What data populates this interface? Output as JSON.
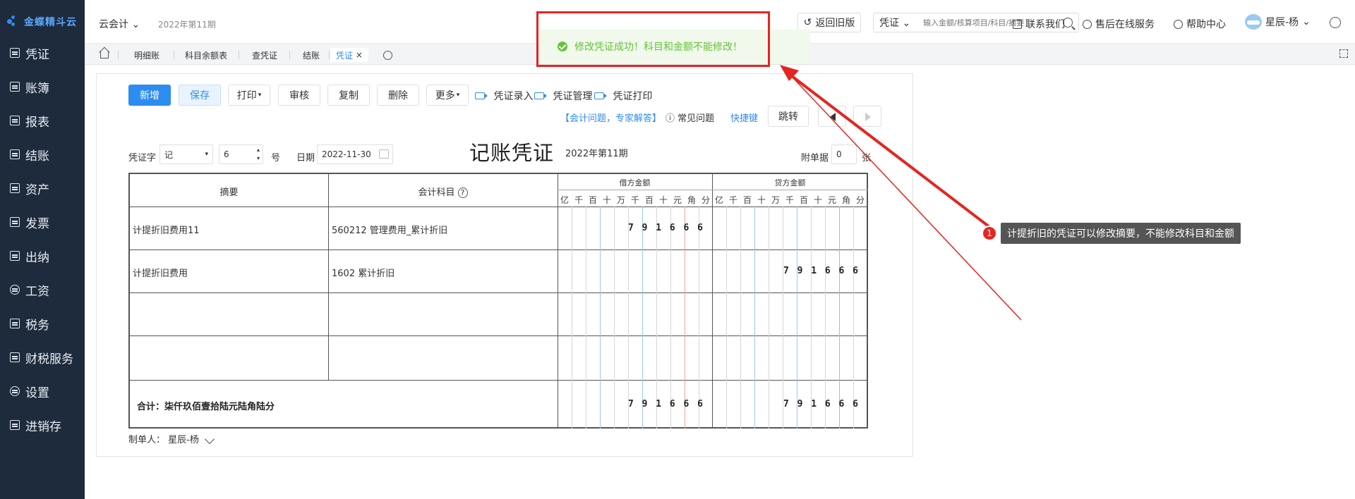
{
  "logo": "金蝶精斗云",
  "sidebar": {
    "items": [
      {
        "label": "凭证"
      },
      {
        "label": "账簿"
      },
      {
        "label": "报表"
      },
      {
        "label": "结账"
      },
      {
        "label": "资产"
      },
      {
        "label": "发票"
      },
      {
        "label": "出纳"
      },
      {
        "label": "工资"
      },
      {
        "label": "税务"
      },
      {
        "label": "财税服务"
      },
      {
        "label": "设置"
      },
      {
        "label": "进销存"
      }
    ]
  },
  "header": {
    "app": "云会计",
    "period": "2022年第11期",
    "return_label": "返回旧版",
    "search_scope": "凭证",
    "search_placeholder": "输入金额/核算项目/科目/摘要",
    "contact": "联系我们",
    "service": "售后在线服务",
    "help": "帮助中心",
    "user": "星辰-杨"
  },
  "tabs": [
    "明细账",
    "科目余额表",
    "查凭证",
    "结账",
    "凭证"
  ],
  "toast": "修改凭证成功！科目和金额不能修改！",
  "toolbar": {
    "new": "新增",
    "save": "保存",
    "print": "打印",
    "audit": "审核",
    "copy": "复制",
    "delete": "删除",
    "more": "更多",
    "entry": "凭证录入",
    "manage": "凭证管理",
    "print_voucher": "凭证打印",
    "qa": "【会计问题，专家解答】",
    "faq": "常见问题",
    "shortcut": "快捷键",
    "jump": "跳转"
  },
  "form": {
    "word_label": "凭证字",
    "word_value": "记",
    "number_value": "6",
    "number_suffix": "号",
    "date_label": "日期",
    "date_value": "2022-11-30",
    "title": "记账凭证",
    "period": "2022年第11期",
    "attach_label": "附单据",
    "attach_value": "0",
    "attach_unit": "张"
  },
  "voucher": {
    "headers": {
      "summary": "摘要",
      "account": "会计科目",
      "debit": "借方金额",
      "credit": "贷方金额"
    },
    "digit_units": [
      "亿",
      "千",
      "百",
      "十",
      "万",
      "千",
      "百",
      "十",
      "元",
      "角",
      "分"
    ],
    "rows": [
      {
        "summary": "计提折旧费用11",
        "account": "560212 管理费用_累计折旧",
        "debit": "791666",
        "credit": ""
      },
      {
        "summary": "计提折旧费用",
        "account": "1602 累计折旧",
        "debit": "",
        "credit": "791666"
      },
      {
        "summary": "",
        "account": "",
        "debit": "",
        "credit": ""
      },
      {
        "summary": "",
        "account": "",
        "debit": "",
        "credit": ""
      }
    ],
    "total_label": "合计：柒仟玖佰壹拾陆元陆角陆分",
    "total_debit": "791666",
    "total_credit": "791666"
  },
  "maker_label": "制单人：",
  "maker_name": "星辰-杨",
  "annotation": {
    "number": "1",
    "text": "计提折旧的凭证可以修改摘要，不能修改科目和金额"
  },
  "colors": {
    "sidebar": "#1e2b3c",
    "accent": "#2d8cf0",
    "success": "#67c23a",
    "annotation": "#e52521"
  }
}
